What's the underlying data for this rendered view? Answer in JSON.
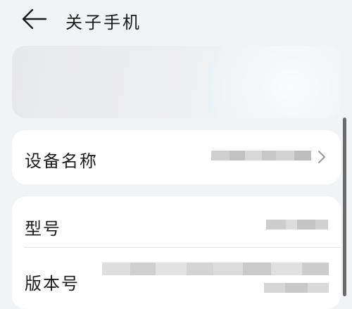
{
  "header": {
    "title": "关子手机",
    "back_icon": "arrow-left-icon"
  },
  "device_card": {
    "label": "设备名称",
    "chevron_icon": "chevron-right-icon"
  },
  "info_card": {
    "model_label": "型号",
    "version_label": "版本号"
  },
  "colors": {
    "background": "#f1f3f5",
    "card": "#ffffff",
    "text": "#1b1b1b",
    "divider": "#e4e4e4"
  }
}
